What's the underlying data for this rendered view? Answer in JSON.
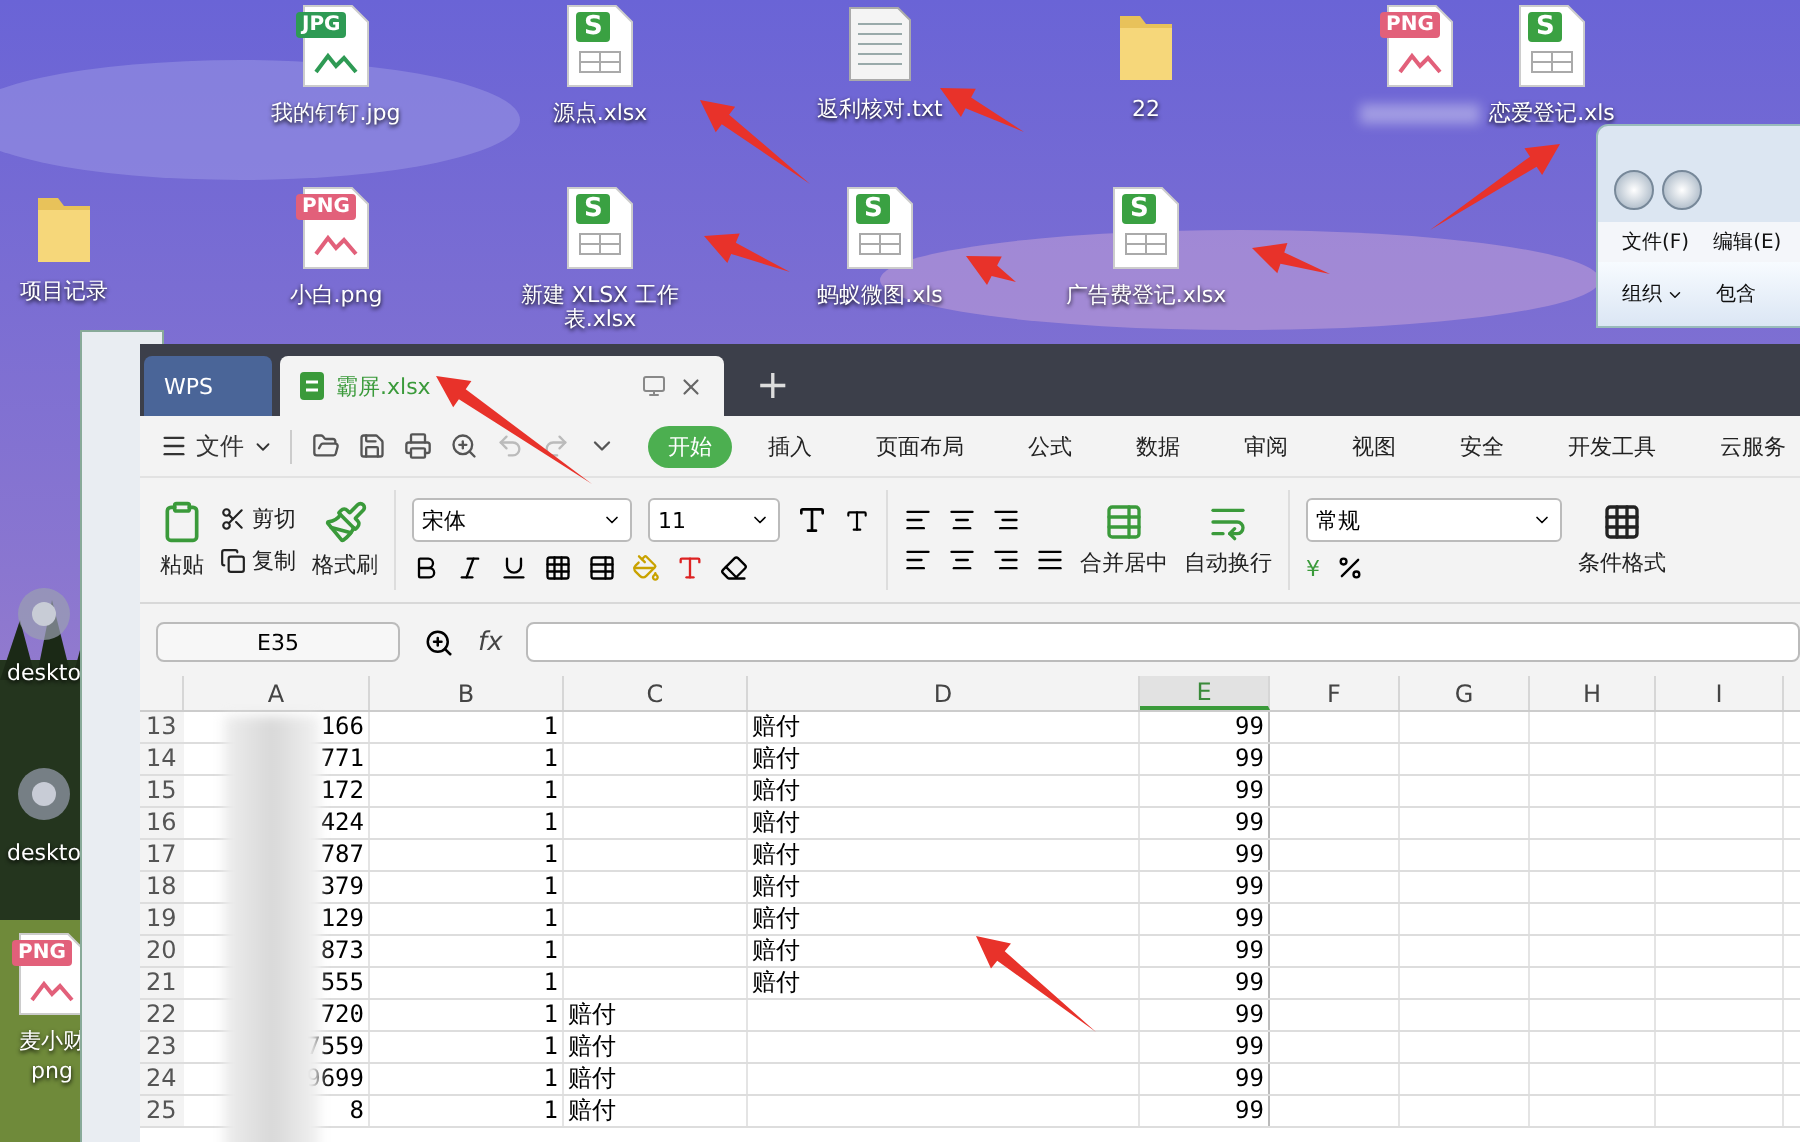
{
  "desktop": {
    "icons": [
      {
        "kind": "jpg",
        "badge": "JPG",
        "label": "我的钉钉.jpg"
      },
      {
        "kind": "xls",
        "badge": "S",
        "label": "源点.xlsx"
      },
      {
        "kind": "txt",
        "label": "返利核对.txt"
      },
      {
        "kind": "folder",
        "label": "22"
      },
      {
        "kind": "png",
        "badge": "PNG"
      },
      {
        "kind": "xls",
        "badge": "S",
        "label": "恋爱登记.xls"
      },
      {
        "kind": "folder",
        "label": "项目记录"
      },
      {
        "kind": "png",
        "badge": "PNG",
        "label": "小白.png"
      },
      {
        "kind": "xls",
        "badge": "S",
        "label": "新建 XLSX 工作表.xlsx"
      },
      {
        "kind": "xls",
        "badge": "S",
        "label": "蚂蚁微图.xls"
      },
      {
        "kind": "xls",
        "badge": "S",
        "label": "广告费登记.xlsx"
      },
      {
        "kind": "gear",
        "label": "deskto"
      },
      {
        "kind": "gear",
        "label": "deskto"
      },
      {
        "kind": "png",
        "badge": "PNG",
        "label": "麦小财",
        "label2": "png"
      }
    ]
  },
  "explorer_window": {
    "menu": [
      "文件(F)",
      "编辑(E)"
    ],
    "toolbar": [
      {
        "label": "组织",
        "dropdown": true
      },
      {
        "label": "包含",
        "dropdown": false
      }
    ]
  },
  "wps": {
    "tabs": [
      {
        "kind": "home",
        "label": "WPS",
        "selected": false
      },
      {
        "kind": "file",
        "label": "霸屏.xlsx",
        "selected": true
      }
    ],
    "new_tab": "+",
    "file_menu": "文件",
    "menu": [
      {
        "label": "开始",
        "selected": true
      },
      {
        "label": "插入",
        "selected": false
      },
      {
        "label": "页面布局",
        "selected": false
      },
      {
        "label": "公式",
        "selected": false
      },
      {
        "label": "数据",
        "selected": false
      },
      {
        "label": "审阅",
        "selected": false
      },
      {
        "label": "视图",
        "selected": false
      },
      {
        "label": "安全",
        "selected": false
      },
      {
        "label": "开发工具",
        "selected": false
      },
      {
        "label": "云服务",
        "selected": false
      }
    ],
    "ribbon": {
      "paste": "粘贴",
      "cut": "剪切",
      "copy": "复制",
      "format_painter": "格式刷",
      "font": "宋体",
      "font_size": "11",
      "merge": "合并居中",
      "wrap": "自动换行",
      "number_format": "常规",
      "currency": "¥",
      "conditional": "条件格式"
    },
    "formula_bar": {
      "cell": "E35",
      "fx": "fx"
    },
    "sheet": {
      "columns": [
        {
          "label": "A",
          "selected": false
        },
        {
          "label": "B",
          "selected": false
        },
        {
          "label": "C",
          "selected": false
        },
        {
          "label": "D",
          "selected": false
        },
        {
          "label": "E",
          "selected": true
        },
        {
          "label": "F",
          "selected": false
        },
        {
          "label": "G",
          "selected": false
        },
        {
          "label": "H",
          "selected": false
        },
        {
          "label": "I",
          "selected": false
        }
      ],
      "rows": [
        {
          "number": "13",
          "cells": [
            "166",
            "1",
            "",
            "赔付",
            "99"
          ]
        },
        {
          "number": "14",
          "cells": [
            "771",
            "1",
            "",
            "赔付",
            "99"
          ]
        },
        {
          "number": "15",
          "cells": [
            "172",
            "1",
            "",
            "赔付",
            "99"
          ]
        },
        {
          "number": "16",
          "cells": [
            "424",
            "1",
            "",
            "赔付",
            "99"
          ]
        },
        {
          "number": "17",
          "cells": [
            "787",
            "1",
            "",
            "赔付",
            "99"
          ]
        },
        {
          "number": "18",
          "cells": [
            "379",
            "1",
            "",
            "赔付",
            "99"
          ]
        },
        {
          "number": "19",
          "cells": [
            "129",
            "1",
            "",
            "赔付",
            "99"
          ]
        },
        {
          "number": "20",
          "cells": [
            "873",
            "1",
            "",
            "赔付",
            "99"
          ]
        },
        {
          "number": "21",
          "cells": [
            "555",
            "1",
            "",
            "赔付",
            "99"
          ]
        },
        {
          "number": "22",
          "cells": [
            "720",
            "1",
            "赔付",
            "",
            "99"
          ]
        },
        {
          "number": "23",
          "cells": [
            "7559",
            "1",
            "赔付",
            "",
            "99"
          ]
        },
        {
          "number": "24",
          "cells": [
            "9699",
            "1",
            "赔付",
            "",
            "99"
          ]
        },
        {
          "number": "25",
          "cells": [
            "8",
            "1",
            "赔付",
            "",
            "99"
          ]
        }
      ]
    }
  }
}
